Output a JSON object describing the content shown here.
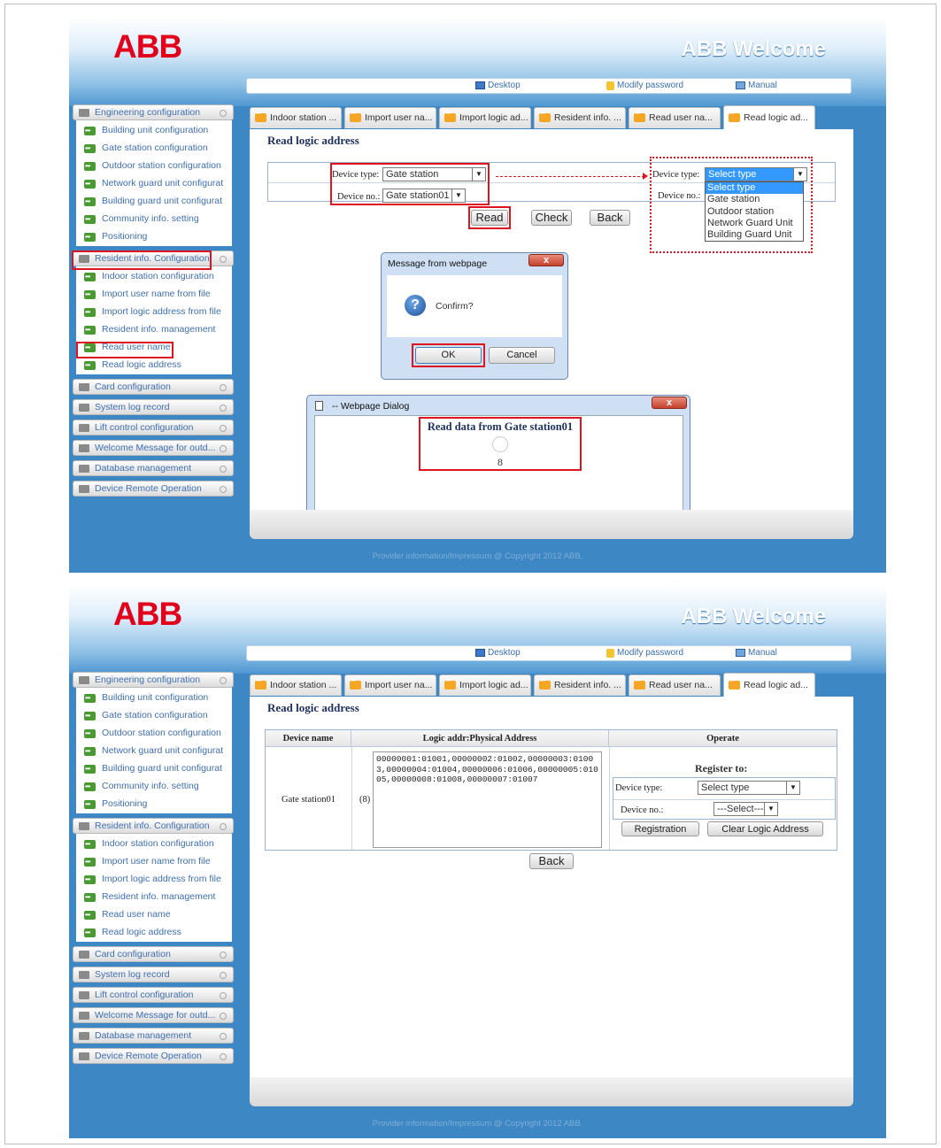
{
  "header": {
    "logo": "ABB",
    "welcome": "ABB Welcome"
  },
  "topbar": {
    "desktop": "Desktop",
    "modify_password": "Modify password",
    "manual": "Manual"
  },
  "sidebar": {
    "engineering": "Engineering configuration",
    "eng_items": [
      "Building unit configuration",
      "Gate station configuration",
      "Outdoor station configuration",
      "Network guard unit configurat",
      "Building guard unit configurat",
      "Community info. setting",
      "Positioning"
    ],
    "resident": "Resident info. Configuration",
    "res_items": [
      "Indoor station configuration",
      "Import user name from file",
      "Import logic address from file",
      "Resident info. management",
      "Read user name",
      "Read logic address"
    ],
    "others": [
      "Card configuration",
      "System log record",
      "Lift control configuration",
      "Welcome Message for outd...",
      "Database management",
      "Device Remote Operation"
    ]
  },
  "tabs": [
    "Indoor station ...",
    "Import user na...",
    "Import logic ad...",
    "Resident info. ...",
    "Read user na...",
    "Read logic ad..."
  ],
  "page_title": "Read logic address",
  "copyright": "Provider information/Impressum @ Copyright 2012 ABB.",
  "screen1": {
    "device_type_label": "Device type:",
    "device_type_value": "Gate station",
    "device_no_label": "Device no.:",
    "device_no_value": "Gate station01",
    "read": "Read",
    "check": "Check",
    "back": "Back",
    "dropdown_label": "Device type:",
    "dropdown_value": "Select type",
    "dropdown_no_label": "Device no.:",
    "dropdown_options": [
      "Select type",
      "Gate station",
      "Outdoor station",
      "Network Guard Unit",
      "Building Guard Unit"
    ],
    "msg_title": "Message from webpage",
    "msg_text": "Confirm?",
    "ok": "OK",
    "cancel": "Cancel",
    "dialog_title": "-- Webpage Dialog",
    "dialog_text": "Read data from Gate station01",
    "dialog_count": "8"
  },
  "screen2": {
    "col_device": "Device name",
    "col_logic": "Logic addr:Physical Address",
    "col_operate": "Operate",
    "device_name": "Gate station01",
    "count": "(8)",
    "addresses": "00000001:01001,00000002:01002,00000003:01003,00000004:01004,00000006:01006,00000005:01005,00000008:01008,00000007:01007",
    "register_to": "Register to:",
    "device_type_label": "Device type:",
    "device_type_value": "Select type",
    "device_no_label": "Device no.:",
    "device_no_value": "---Select---",
    "registration": "Registration",
    "clear": "Clear Logic Address",
    "back": "Back"
  }
}
